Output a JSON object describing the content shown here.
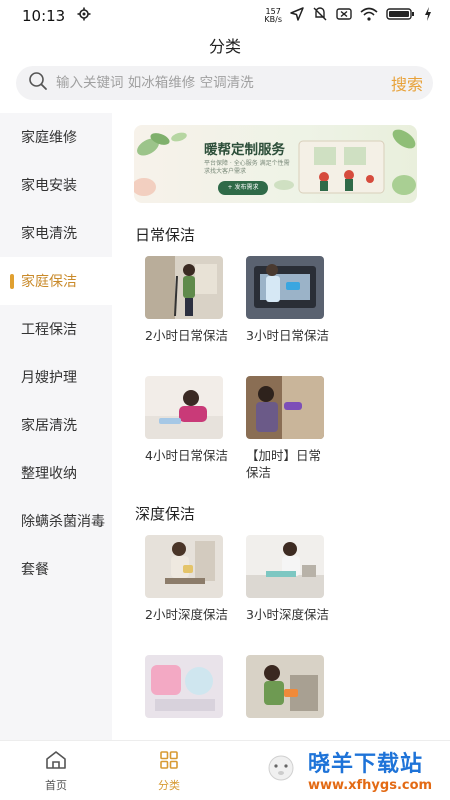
{
  "status_bar": {
    "time": "10:13",
    "net_speed_value": "157",
    "net_speed_unit": "KB/s"
  },
  "header": {
    "title": "分类"
  },
  "search": {
    "placeholder": "输入关键词 如冰箱维修 空调清洗",
    "button_label": "搜索"
  },
  "sidebar": {
    "items": [
      {
        "label": "家庭维修",
        "active": false
      },
      {
        "label": "家电安装",
        "active": false
      },
      {
        "label": "家电清洗",
        "active": false
      },
      {
        "label": "家庭保洁",
        "active": true
      },
      {
        "label": "工程保洁",
        "active": false
      },
      {
        "label": "月嫂护理",
        "active": false
      },
      {
        "label": "家居清洗",
        "active": false
      },
      {
        "label": "整理收纳",
        "active": false
      },
      {
        "label": "除螨杀菌消毒",
        "active": false
      },
      {
        "label": "套餐",
        "active": false
      }
    ]
  },
  "banner": {
    "title": "暖帮定制服务",
    "subtitle": "平台保障 · 全心服务 满足个性需求找大客户需求",
    "button": "+ 发布需求"
  },
  "sections": [
    {
      "title": "日常保洁",
      "items": [
        "2小时日常保洁",
        "3小时日常保洁",
        "4小时日常保洁",
        "【加时】日常保洁"
      ]
    },
    {
      "title": "深度保洁",
      "items": [
        "2小时深度保洁",
        "3小时深度保洁",
        "",
        ""
      ]
    }
  ],
  "tabbar": {
    "tabs": [
      {
        "label": "首页"
      },
      {
        "label": "分类"
      },
      {
        "label": ""
      },
      {
        "label": ""
      }
    ]
  },
  "watermark": {
    "title": "晓羊下载站",
    "url": "www.xfhygs.com"
  },
  "colors": {
    "accent": "#e0a030",
    "sidebar_bg": "#f6f6f8",
    "watermark_blue": "#1e73d8",
    "watermark_orange": "#e36a14"
  }
}
